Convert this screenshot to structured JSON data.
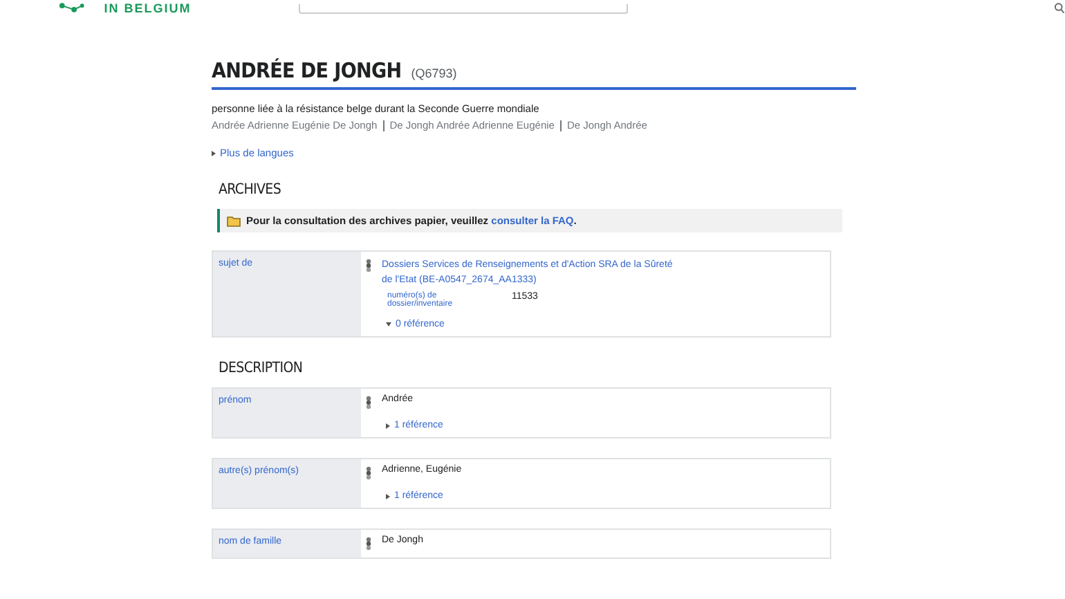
{
  "header": {
    "logo_text": "IN BELGIUM"
  },
  "entity": {
    "title": "ANDRÉE DE JONGH",
    "id": "(Q6793)",
    "description": "personne liée à la résistance belge durant la Seconde Guerre mondiale",
    "aliases": [
      "Andrée Adrienne Eugénie De Jongh",
      "De Jongh Andrée Adrienne Eugénie",
      "De Jongh Andrée"
    ],
    "more_languages": {
      "label": "Plus de langues",
      "expanded": false
    }
  },
  "sections": [
    {
      "heading": "ARCHIVES",
      "notice": {
        "text": "Pour la consultation des archives papier, veuillez ",
        "link": "consulter la FAQ",
        "after": "."
      },
      "statements": [
        {
          "property": "sujet de",
          "kind": "item",
          "value": "Dossiers Services de Renseignements et d'Action SRA de la Sûreté de l'Etat (BE-A0547_2674_AA1333)",
          "qualifiers": [
            {
              "property": "numéro(s) de dossier/inventaire",
              "value": "11533"
            }
          ],
          "references": {
            "label": "0 référence",
            "expanded": true
          }
        }
      ]
    },
    {
      "heading": "DESCRIPTION",
      "statements": [
        {
          "property": "prénom",
          "kind": "string",
          "value": "Andrée",
          "references": {
            "label": "1 référence",
            "expanded": false
          }
        },
        {
          "property": "autre(s) prénom(s)",
          "kind": "string",
          "value": "Adrienne, Eugénie",
          "references": {
            "label": "1 référence",
            "expanded": false
          }
        },
        {
          "property": "nom de famille",
          "kind": "string",
          "value": "De Jongh"
        }
      ]
    }
  ]
}
